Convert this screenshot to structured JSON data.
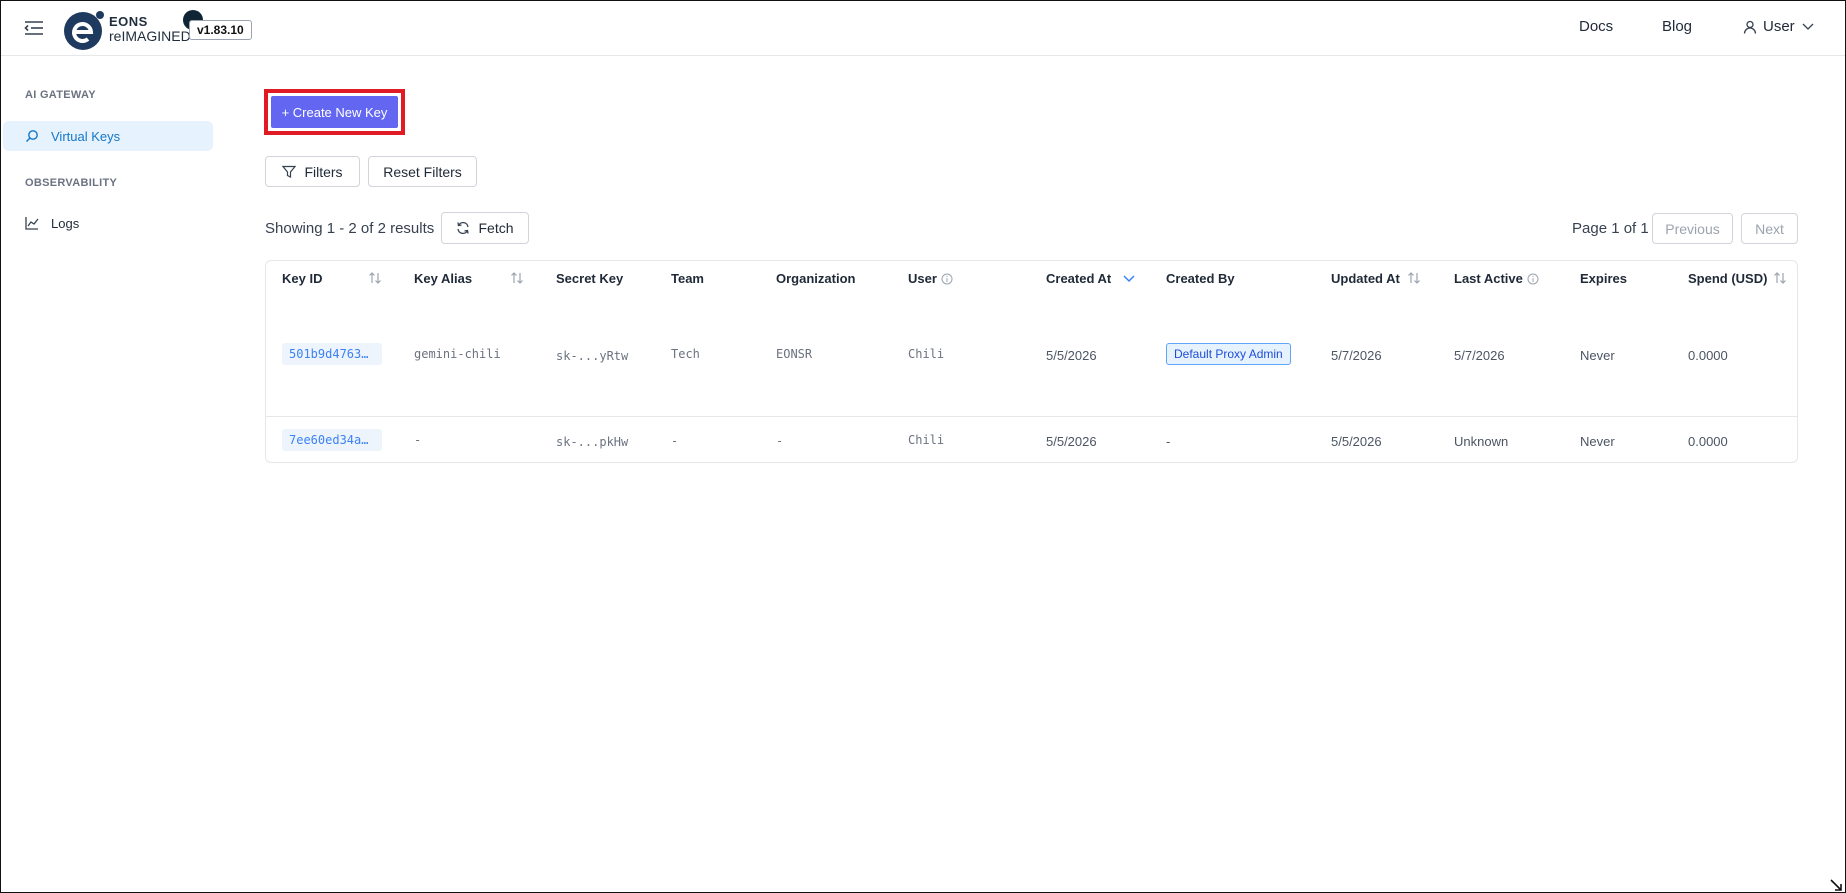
{
  "header": {
    "brand_line1": "EONS",
    "brand_line2": "reIMAGINED",
    "version": "v1.83.10",
    "nav": {
      "docs": "Docs",
      "blog": "Blog",
      "user": "User"
    }
  },
  "sidebar": {
    "sections": [
      {
        "title": "AI GATEWAY",
        "items": [
          {
            "label": "Virtual Keys",
            "icon": "search-icon",
            "active": true
          }
        ]
      },
      {
        "title": "OBSERVABILITY",
        "items": [
          {
            "label": "Logs",
            "icon": "line-chart-icon",
            "active": false
          }
        ]
      }
    ]
  },
  "toolbar": {
    "create_key": "+ Create New Key",
    "filters": "Filters",
    "reset_filters": "Reset Filters",
    "fetch": "Fetch"
  },
  "results": {
    "showing": "Showing 1 - 2 of 2 results",
    "page": "Page 1 of 1",
    "previous": "Previous",
    "next": "Next"
  },
  "table": {
    "columns": [
      "Key ID",
      "Key Alias",
      "Secret Key",
      "Team",
      "Organization",
      "User",
      "Created At",
      "Created By",
      "Updated At",
      "Last Active",
      "Expires",
      "Spend (USD)"
    ],
    "rows": [
      {
        "key_id": "501b9d4763…",
        "alias": "gemini-chili",
        "secret": "sk-...yRtw",
        "team": "Tech",
        "org": "EONSR",
        "user": "Chili",
        "created_at": "5/5/2026",
        "created_by": "Default Proxy Admin",
        "updated_at": "5/7/2026",
        "last_active": "5/7/2026",
        "expires": "Never",
        "spend": "0.0000"
      },
      {
        "key_id": "7ee60ed34a…",
        "alias": "-",
        "secret": "sk-...pkHw",
        "team": "-",
        "org": "-",
        "user": "Chili",
        "created_at": "5/5/2026",
        "created_by": "-",
        "updated_at": "5/5/2026",
        "last_active": "Unknown",
        "expires": "Never",
        "spend": "0.0000"
      }
    ]
  },
  "colors": {
    "primary": "#6366f1",
    "highlight_border": "#e01b24",
    "link": "#3b82f6",
    "active_nav_bg": "#e6f2fd"
  }
}
